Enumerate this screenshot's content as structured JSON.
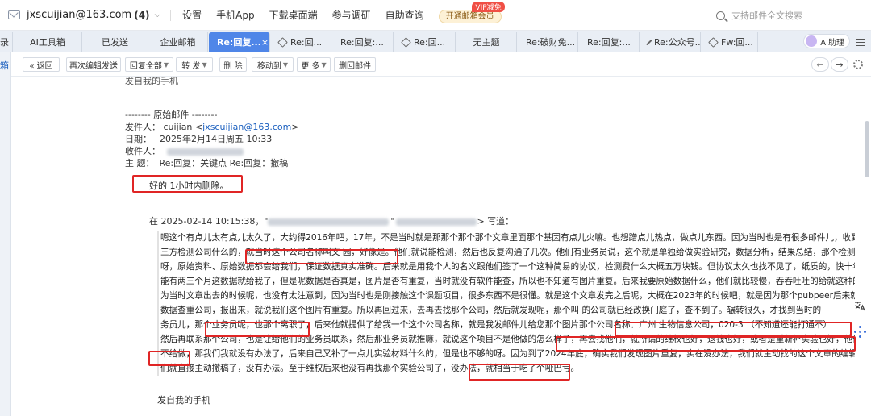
{
  "topbar": {
    "account_email": "jxscuijian@163.com",
    "account_count": "(4)",
    "nav": [
      "设置",
      "手机App",
      "下载桌面端",
      "参与调研",
      "自助查询"
    ],
    "vip_button": "开通邮箱会员",
    "vip_badge": "VIP减免",
    "search_placeholder": "支持邮件全文搜索"
  },
  "tabs": [
    {
      "label": "录"
    },
    {
      "label": "AI工具箱"
    },
    {
      "label": "已发送"
    },
    {
      "label": "企业邮箱"
    },
    {
      "label": "Re:回复...",
      "active": true
    },
    {
      "label": "Re:回..."
    },
    {
      "label": "Re:回复:..."
    },
    {
      "label": "Re:回..."
    },
    {
      "label": "无主题"
    },
    {
      "label": "Re:破财免..."
    },
    {
      "label": "Re:回复:..."
    },
    {
      "label": "Re:公众号..."
    },
    {
      "label": "Fw:回..."
    }
  ],
  "tab_close": "×",
  "ai_assistant": "AI助理",
  "left_strip_label": "箱",
  "toolbar": {
    "back": "« 返回",
    "re_edit": "再次编辑发送",
    "reply_all": "回复全部",
    "forward": "转 发",
    "delete": "删 除",
    "move_to": "移动到",
    "more": "更 多",
    "delete_mail": "删回邮件",
    "prev_arrow": "←",
    "next_arrow": "→"
  },
  "email": {
    "cut_line": "发自我的手机",
    "original_header": "-------- 原始邮件 --------",
    "from_label": "发件人：",
    "from_name": "cuijian <",
    "from_email": "jxscuijian@163.com",
    "from_end": ">",
    "date_label": "日期：",
    "date_value": "2025年2月14日周五 10:33",
    "to_label": "收件人：",
    "subject_label": "主 题：",
    "subject_value": "Re:回复：关键点 Re:回复：撤稿",
    "reply": "好的 1小时内删除。",
    "quote_prefix": "在 2025-02-14 10:15:38，\"",
    "quote_suffix": "> 写道：",
    "lines": [
      "嗯这个有点儿太有点儿太久了，大约得2016年吧，17年，不是当时就是那那个那个那个文章里面那个基因有点儿火嘛。也想蹭点儿热点，做点儿东西。因为当时也是有很多邮件儿，收到这种第",
      "三方检测公司什么的，就当时这个公司名称叫文  园，好像是。他们就说能检测，然后也反复沟通了几次。他们有业务员说，这个就是单独给做实验研究，数据分析，结果总结，那个检测图片",
      "呀，原始资料、原始数据都会给我们，保证数据真实准确。后来就是用我个人的名义跟他们签了一个这种简易的协议，检测费什么大概五万块钱。但协议太久也找不见了，纸质的，快十年了。可",
      "能有两三个月这数据就给我了，但是呢数据是否真是，图片是否有重复，当时就没有软件能查，所以也不知道有图片重复。后来我要原始数据什么，他们就比较慢，吞吞吐吐的给就这种的，因",
      "为当时文章出去的时候呢，也没有太注意到，因为当时也是刚接触这个课题项目，很多东西不是很懂。就是这个文章发完之后呢，大概在2023年的时候吧，就是因为那个pubpeer后来就是国内的",
      "数据查重公司，报出来，就说我们这个图片有重复。所以再回过来，去再去找那个公司，然后就发现呢，那个叫      的公司就已经改换门庭了，查不到了。辗转很久，才找到当时的",
      "务员儿，那个业务员呢，也那个离职了，后来他就提供了给我一个这个公司名称，就是我发邮件儿给您那个图片那个公司名称：广州   生物信息公司，020-3       （不知道还能打通不）",
      "然后再联系那个公司，也是让给他们的业务员联系，然后那业务员就推嘛，就说这个项目不是他做的怎么样子，再去找他们，就所谓的维权也好，退钱也好，或者是重新补实验也好，他们就一",
      "不给做，那我们我就没有办法了，后来自己又补了一点儿实验材料什么的，但是也不够的呀。因为到了2024年底，确实我们发现图片重复，实在没办法，我们就主动找的这个文章的编辑部，我",
      "们就直接主动撤稿了，没有办法。至于维权后来也没有再找那个实验公司了，没办法，就相当于吃了个哑巴亏。"
    ],
    "signoff": "发自我的手机"
  },
  "colors": {
    "accent": "#4f86e8",
    "link": "#1a5fbf",
    "highlight_box": "#e02525"
  }
}
